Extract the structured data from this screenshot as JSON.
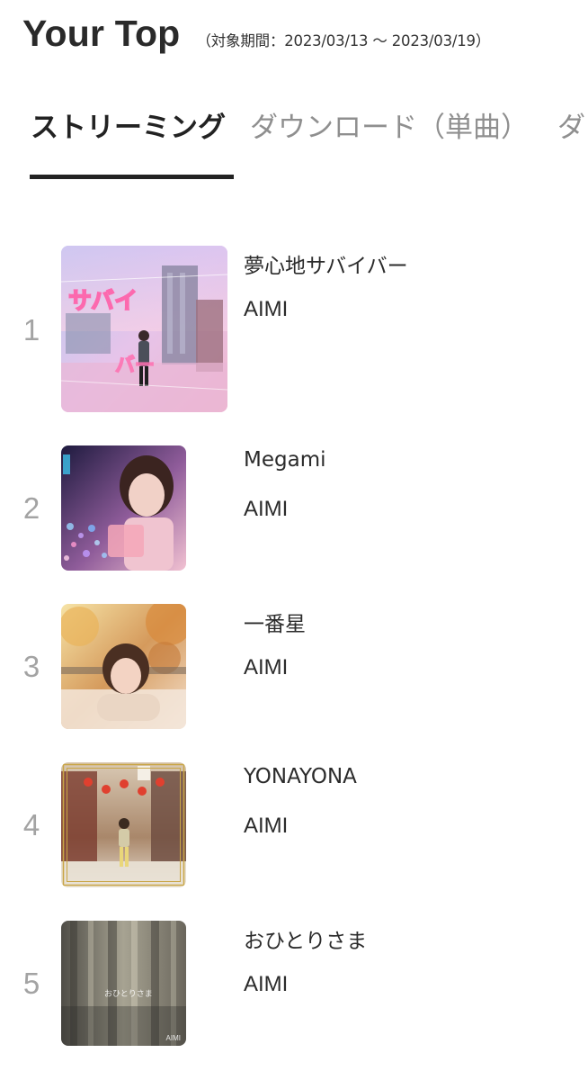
{
  "header": {
    "title": "Your Top",
    "period": "（対象期間：2023/03/13 〜 2023/03/19）"
  },
  "tabs": [
    {
      "label": "ストリーミング",
      "active": true
    },
    {
      "label": "ダウンロード（単曲）",
      "active": false
    },
    {
      "label": "ダ",
      "active": false
    }
  ],
  "ranking": [
    {
      "rank": "1",
      "title": "夢心地サバイバー",
      "artist": "AIMI",
      "art_text": "夢心地サバイバー",
      "art_colors": [
        "#c9d6f2",
        "#e8c3e8",
        "#f3b7c9"
      ]
    },
    {
      "rank": "2",
      "title": "Megami",
      "artist": "AIMI",
      "art_colors": [
        "#2a1f4d",
        "#c58fb5",
        "#f2c6d3"
      ]
    },
    {
      "rank": "3",
      "title": "一番星",
      "artist": "AIMI",
      "art_colors": [
        "#f3d78a",
        "#c98b4c",
        "#f5e2c8"
      ]
    },
    {
      "rank": "4",
      "title": "YONAYONA",
      "artist": "AIMI",
      "art_colors": [
        "#6b3a2e",
        "#c9a56a",
        "#e9ddd0"
      ]
    },
    {
      "rank": "5",
      "title": "おひとりさま",
      "artist": "AIMI",
      "art_text": "おひとりさま",
      "art_corner": "AIMI",
      "art_colors": [
        "#5b5a52",
        "#9b9887",
        "#cfc8b5"
      ]
    }
  ]
}
